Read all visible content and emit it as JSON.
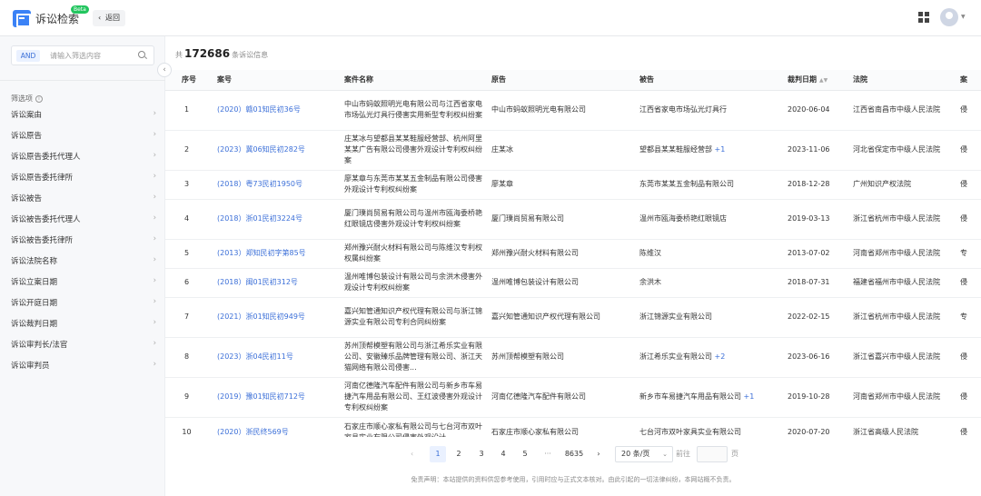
{
  "header": {
    "app_title": "诉讼检索",
    "beta_badge": "Beta",
    "back_label": "返回",
    "icons": [
      "app-logo-icon",
      "grid-apps-icon",
      "user-avatar",
      "caret-down-icon"
    ]
  },
  "sidebar": {
    "search": {
      "and_tag": "AND",
      "placeholder": "请输入筛选内容"
    },
    "filter_heading": "筛选项",
    "items": [
      {
        "label": "诉讼案由"
      },
      {
        "label": "诉讼原告"
      },
      {
        "label": "诉讼原告委托代理人"
      },
      {
        "label": "诉讼原告委托律所"
      },
      {
        "label": "诉讼被告"
      },
      {
        "label": "诉讼被告委托代理人"
      },
      {
        "label": "诉讼被告委托律所"
      },
      {
        "label": "诉讼法院名称"
      },
      {
        "label": "诉讼立案日期"
      },
      {
        "label": "诉讼开庭日期"
      },
      {
        "label": "诉讼裁判日期"
      },
      {
        "label": "诉讼审判长/法官"
      },
      {
        "label": "诉讼审判员"
      }
    ]
  },
  "main": {
    "count_prefix": "共",
    "count_value": "172686",
    "count_suffix": "条诉讼信息",
    "columns": [
      "序号",
      "案号",
      "案件名称",
      "原告",
      "被告",
      "裁判日期",
      "法院",
      "案"
    ],
    "rows": [
      {
        "idx": "1",
        "case_no": "(2020）赣01知民初36号",
        "name": "中山市蚂蚁照明光电有限公司与江西省家电市场弘光灯具行侵害实用新型专利权纠纷案",
        "plaintiff": "中山市蚂蚁照明光电有限公司",
        "defendant": "江西省家电市场弘光灯具行",
        "defendant_more": "",
        "date": "2020-06-04",
        "court": "江西省南昌市中级人民法院",
        "extra": "侵"
      },
      {
        "idx": "2",
        "case_no": "(2023）冀06知民初282号",
        "name": "庄某冰与望都县某某鞋服经营部、杭州阿里某某广告有限公司侵害外观设计专利权纠纷案",
        "plaintiff": "庄某冰",
        "defendant": "望都县某某鞋服经营部",
        "defendant_more": "+1",
        "date": "2023-11-06",
        "court": "河北省保定市中级人民法院",
        "extra": "侵"
      },
      {
        "idx": "3",
        "case_no": "(2018）粤73民初1950号",
        "name": "廖某章与东莞市某某五金制品有限公司侵害外观设计专利权纠纷案",
        "plaintiff": "廖某章",
        "defendant": "东莞市某某五金制品有限公司",
        "defendant_more": "",
        "date": "2018-12-28",
        "court": "广州知识产权法院",
        "extra": "侵"
      },
      {
        "idx": "4",
        "case_no": "(2018）浙01民初3224号",
        "name": "厦门璞尚贸易有限公司与温州市瓯海委桥艳红眼镜店侵害外观设计专利权纠纷案",
        "plaintiff": "厦门璞尚贸易有限公司",
        "defendant": "温州市瓯海委桥艳红眼镜店",
        "defendant_more": "",
        "date": "2019-03-13",
        "court": "浙江省杭州市中级人民法院",
        "extra": "侵"
      },
      {
        "idx": "5",
        "case_no": "(2013）郑知民初字第85号",
        "name": "郑州豫兴耐火材料有限公司与陈维汉专利权权属纠纷案",
        "plaintiff": "郑州豫兴耐火材料有限公司",
        "defendant": "陈维汉",
        "defendant_more": "",
        "date": "2013-07-02",
        "court": "河南省郑州市中级人民法院",
        "extra": "专"
      },
      {
        "idx": "6",
        "case_no": "(2018）闽01民初312号",
        "name": "温州唯博包装设计有限公司与余洪木侵害外观设计专利权纠纷案",
        "plaintiff": "温州唯博包装设计有限公司",
        "defendant": "余洪木",
        "defendant_more": "",
        "date": "2018-07-31",
        "court": "福建省福州市中级人民法院",
        "extra": "侵"
      },
      {
        "idx": "7",
        "case_no": "(2021）浙01知民初949号",
        "name": "嘉兴知管通知识产权代理有限公司与浙江锦源实业有限公司专利合同纠纷案",
        "plaintiff": "嘉兴知管通知识产权代理有限公司",
        "defendant": "浙江锦源实业有限公司",
        "defendant_more": "",
        "date": "2022-02-15",
        "court": "浙江省杭州市中级人民法院",
        "extra": "专"
      },
      {
        "idx": "8",
        "case_no": "(2023）浙04民初11号",
        "name": "苏州顶帮模塑有限公司与浙江希乐实业有限公司、安徽臻乐品牌管理有限公司、浙江天猫网络有限公司侵害...",
        "plaintiff": "苏州顶帮模塑有限公司",
        "defendant": "浙江希乐实业有限公司",
        "defendant_more": "+2",
        "date": "2023-06-16",
        "court": "浙江省嘉兴市中级人民法院",
        "extra": "侵"
      },
      {
        "idx": "9",
        "case_no": "(2019）豫01知民初712号",
        "name": "河南亿德隆汽车配件有限公司与新乡市车易捷汽车用品有限公司、王红波侵害外观设计专利权纠纷案",
        "plaintiff": "河南亿德隆汽车配件有限公司",
        "defendant": "新乡市车易捷汽车用品有限公司",
        "defendant_more": "+1",
        "date": "2019-10-28",
        "court": "河南省郑州市中级人民法院",
        "extra": "侵"
      },
      {
        "idx": "10",
        "case_no": "(2020）浙民终569号",
        "name": "石家庄市顺心家私有限公司与七台河市双叶家具实业有限公司侵害外观设计",
        "plaintiff": "石家庄市顺心家私有限公司",
        "defendant": "七台河市双叶家具实业有限公司",
        "defendant_more": "",
        "date": "2020-07-20",
        "court": "浙江省高级人民法院",
        "extra": "侵"
      }
    ]
  },
  "pagination": {
    "prev": "‹",
    "pages": [
      "1",
      "2",
      "3",
      "4",
      "5"
    ],
    "ellipsis": "···",
    "last_page": "8635",
    "next": "›",
    "page_size": "20 条/页",
    "goto_label": "前往",
    "page_unit": "页"
  },
  "disclaimer": "免责声明：本站提供的资料供您参考使用，引用时应与正式文本核对。由此引起的一切法律纠纷，本网站概不负责。"
}
